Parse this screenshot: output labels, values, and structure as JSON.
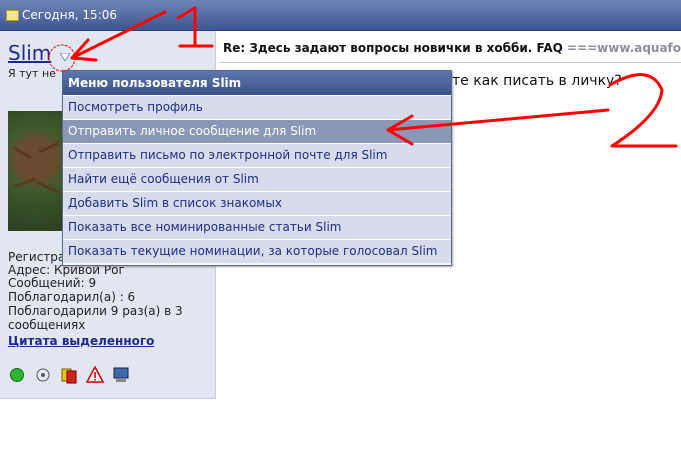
{
  "topbar": {
    "date": "Сегодня, 15:06",
    "icon": "document-icon"
  },
  "user": {
    "name": "Slim",
    "title": "Я тут не",
    "info": {
      "registered": "Регистра",
      "address": "Адрес: Кривой Рог",
      "messages": "Сообщений: 9",
      "thanked": "Поблагодарил(а) : 6",
      "thanked_by_1": "Поблагодарили 9 раз(а) в 3",
      "thanked_by_2": "сообщениях"
    },
    "quote_link": "Цитата выделенного",
    "icons": [
      "online-status-icon",
      "reputation-icon",
      "warning-card-icon",
      "report-icon",
      "computer-icon"
    ]
  },
  "post": {
    "title": "Re: Здесь задают вопросы новички в хобби. FAQ",
    "title_link": "===www.aquafor",
    "text": "те как писать в личку?"
  },
  "menu": {
    "header": "Меню пользователя Slim",
    "items": [
      "Посмотреть профиль",
      "Отправить личное сообщение для Slim",
      "Отправить письмо по электронной почте для Slim",
      "Найти ещё сообщения от Slim",
      "Добавить Slim в список знакомых",
      "Показать все номинированные статьи Slim",
      "Показать текущие номинации, за которые голосовал Slim"
    ],
    "active_index": 1
  },
  "annotations": {
    "label_1": "1",
    "label_2": "2",
    "color": "#ff0000"
  }
}
